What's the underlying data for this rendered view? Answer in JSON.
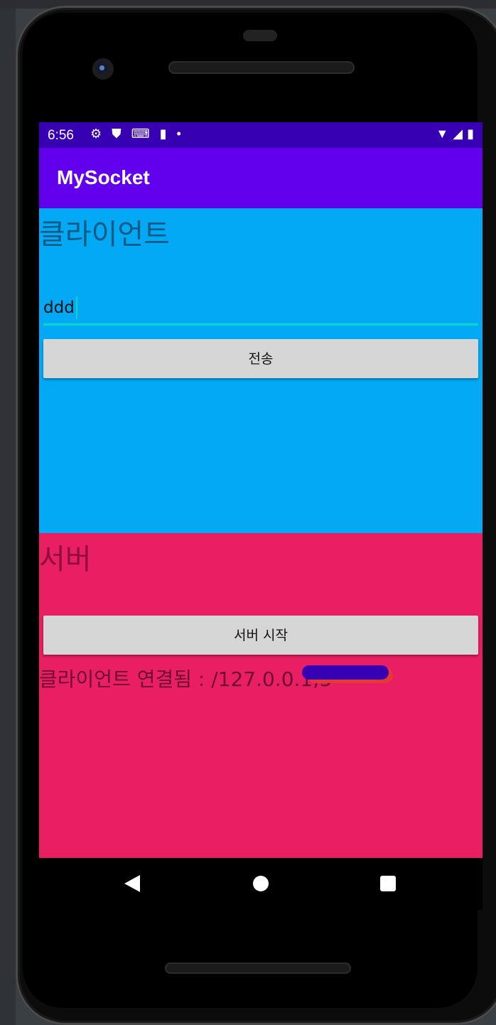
{
  "status_bar": {
    "time": "6:56",
    "left_icons": [
      "gear-icon",
      "shield-icon",
      "keyboard-icon",
      "sd-card-icon",
      "dot-icon"
    ],
    "right_icons": [
      "wifi-icon",
      "signal-icon",
      "battery-icon"
    ]
  },
  "app_bar": {
    "title": "MySocket",
    "color": "#6200ee"
  },
  "client": {
    "heading": "클라이언트",
    "input_value": "ddd",
    "send_label": "전송",
    "background": "#03a9f4"
  },
  "server": {
    "heading": "서버",
    "start_label": "서버 시작",
    "status_text": "클라이언트 연결됨 : /127.0.0.1;5",
    "background": "#e91e63"
  },
  "nav": {
    "icons": [
      "back-icon",
      "home-icon",
      "recents-icon"
    ]
  }
}
